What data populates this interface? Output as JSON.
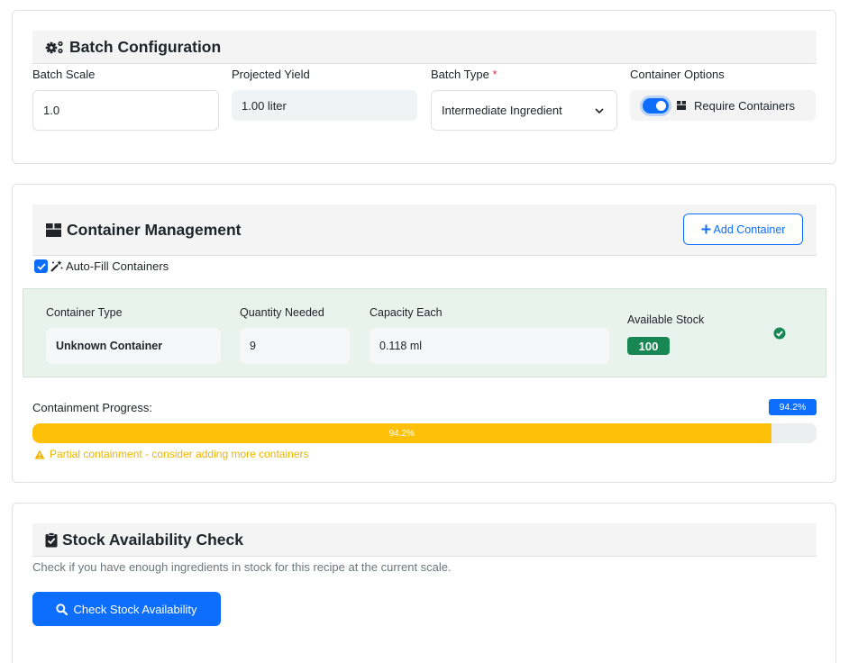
{
  "batch_config": {
    "title": "Batch Configuration",
    "icon": "gears-icon",
    "scale_label": "Batch Scale",
    "scale_value": "1.0",
    "yield_label": "Projected Yield",
    "yield_value": "1.00 liter",
    "type_label": "Batch Type",
    "required_mark": "*",
    "type_value": "Intermediate Ingredient",
    "container_options_label": "Container Options",
    "require_containers_label": "Require Containers",
    "require_containers_on": true
  },
  "container_mgmt": {
    "title": "Container Management",
    "icon": "box-icon",
    "add_button": "Add Container",
    "autofill_label": "Auto-Fill Containers",
    "autofill_checked": true,
    "row": {
      "type_label": "Container Type",
      "type_value": "Unknown Container",
      "qty_label": "Quantity Needed",
      "qty_value": "9",
      "capacity_label": "Capacity Each",
      "capacity_value": "0.118 ml",
      "stock_label": "Available Stock",
      "stock_value": "100",
      "status_icon": "check-circle-icon"
    },
    "progress_label": "Containment Progress:",
    "progress_badge": "94.2%",
    "progress_text": "94.2%",
    "progress_value": 94.2,
    "warning": "Partial containment - consider adding more containers"
  },
  "stock_check": {
    "title": "Stock Availability Check",
    "icon": "clipboard-check-icon",
    "description": "Check if you have enough ingredients in stock for this recipe at the current scale.",
    "button": "Check Stock Availability"
  },
  "colors": {
    "primary": "#0d6efd",
    "success": "#198754",
    "warning": "#ffc107",
    "danger": "#dc3545"
  }
}
